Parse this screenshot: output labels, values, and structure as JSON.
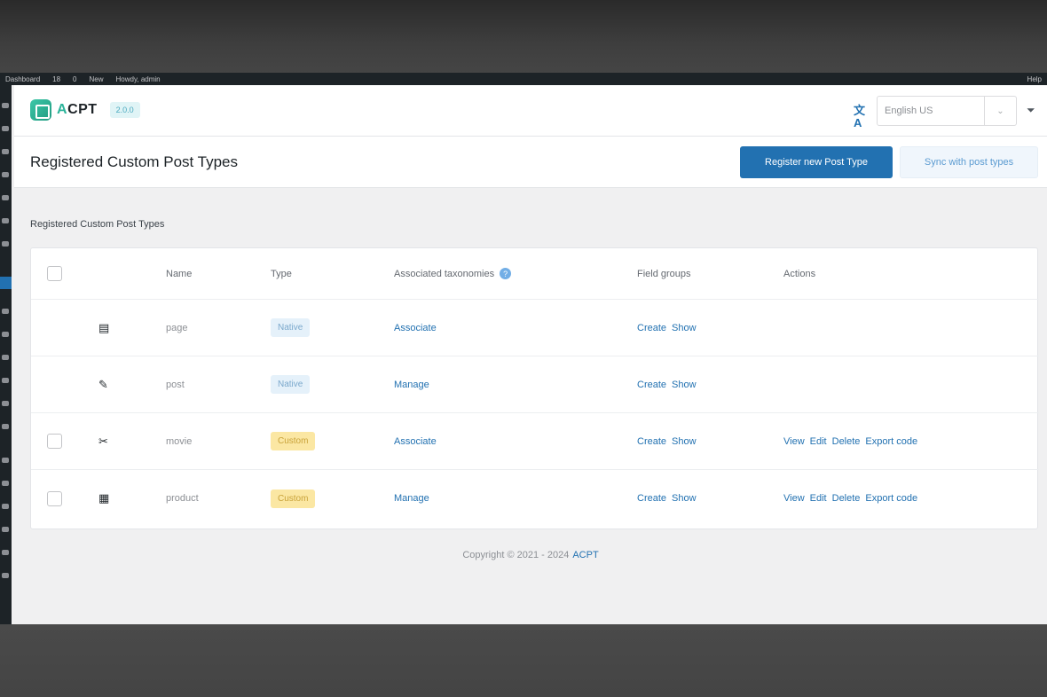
{
  "adminbar": {
    "items": [
      "Dashboard",
      "18",
      "0",
      "New",
      "Howdy, admin"
    ],
    "right": "Help"
  },
  "header": {
    "logo_text_a": "A",
    "logo_text_rest": "CPT",
    "version": "2.0.0",
    "language": "English US",
    "caret": "⌄",
    "translate_icon": "文A",
    "filter_icon": "⏷"
  },
  "page": {
    "title": "Registered Custom Post Types",
    "primary_button": "Register new Post Type",
    "secondary_button": "Sync with post types",
    "breadcrumb": "Registered Custom Post Types"
  },
  "table": {
    "columns": {
      "name": "Name",
      "type": "Type",
      "taxonomies": "Associated taxonomies",
      "field_groups": "Field groups",
      "actions": "Actions"
    },
    "help_glyph": "?",
    "rows": [
      {
        "icon": "▤",
        "name": "page",
        "type": "Native",
        "type_kind": "native",
        "taxonomy_link": "Associate",
        "fg_create": "Create",
        "fg_show": "Show",
        "has_checkbox": false,
        "actions": []
      },
      {
        "icon": "✎",
        "name": "post",
        "type": "Native",
        "type_kind": "native",
        "taxonomy_link": "Manage",
        "fg_create": "Create",
        "fg_show": "Show",
        "has_checkbox": false,
        "actions": []
      },
      {
        "icon": "✂",
        "name": "movie",
        "type": "Custom",
        "type_kind": "custom",
        "taxonomy_link": "Associate",
        "fg_create": "Create",
        "fg_show": "Show",
        "has_checkbox": true,
        "actions": [
          "View",
          "Edit",
          "Delete",
          "Export code"
        ]
      },
      {
        "icon": "▦",
        "name": "product",
        "type": "Custom",
        "type_kind": "custom",
        "taxonomy_link": "Manage",
        "fg_create": "Create",
        "fg_show": "Show",
        "has_checkbox": true,
        "actions": [
          "View",
          "Edit",
          "Delete",
          "Export code"
        ]
      }
    ]
  },
  "footer": {
    "copyright": "Copyright © 2021 - 2024",
    "brand_link": "ACPT"
  },
  "colors": {
    "accent": "#2271b1",
    "brand": "#2bb39a",
    "native_badge": "#e5f1fa",
    "custom_badge": "#fbe7a3"
  }
}
